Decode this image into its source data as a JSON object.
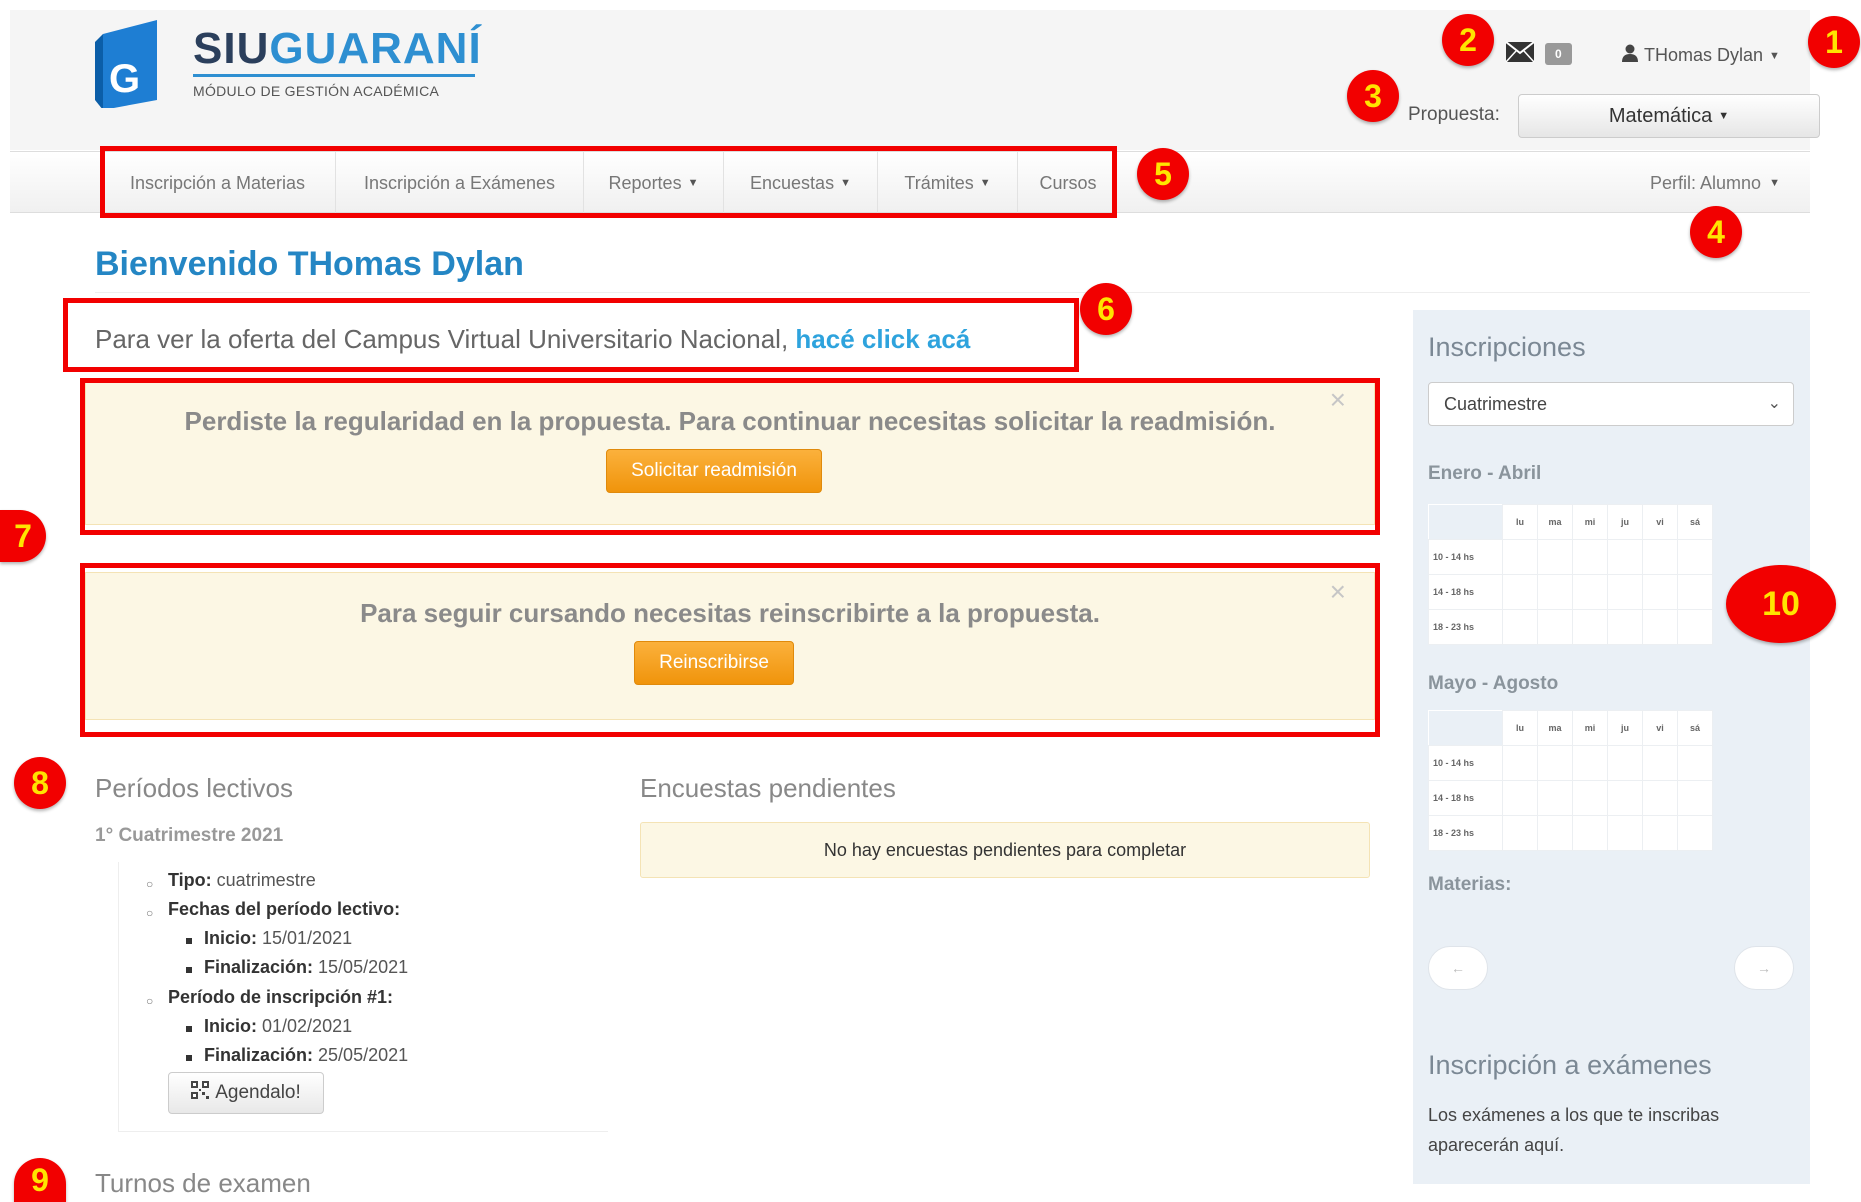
{
  "header": {
    "logo_siu": "SIU",
    "logo_guarani": "GUARANÍ",
    "logo_subtitle": "MÓDULO DE GESTIÓN ACADÉMICA",
    "mail_count": "0",
    "user_name": "THomas Dylan",
    "propuesta_label": "Propuesta:",
    "propuesta_value": "Matemática"
  },
  "nav": {
    "items": [
      {
        "label": "Inscripción a Materias"
      },
      {
        "label": "Inscripción a Exámenes"
      },
      {
        "label": "Reportes"
      },
      {
        "label": "Encuestas"
      },
      {
        "label": "Trámites"
      },
      {
        "label": "Cursos"
      }
    ],
    "perfil": "Perfil: Alumno"
  },
  "markers": [
    "1",
    "2",
    "3",
    "4",
    "5",
    "6",
    "7",
    "8",
    "9",
    "10"
  ],
  "main": {
    "welcome": "Bienvenido THomas Dylan",
    "oferta_text": "Para ver la oferta del Campus Virtual Universitario Nacional,",
    "oferta_link": "hacé click acá",
    "alert1": {
      "text": "Perdiste la regularidad en la propuesta. Para continuar necesitas solicitar la readmisión.",
      "button": "Solicitar readmisión",
      "close": "×"
    },
    "alert2": {
      "text": "Para seguir cursando necesitas reinscribirte a la propuesta.",
      "button": "Reinscribirse",
      "close": "×"
    },
    "periodos": {
      "title": "Períodos lectivos",
      "subtitle": "1° Cuatrimestre 2021",
      "tipo_label": "Tipo:",
      "tipo_value": "cuatrimestre",
      "fechas_label": "Fechas del período lectivo:",
      "inicio_label": "Inicio:",
      "inicio_value": "15/01/2021",
      "fin_label": "Finalización:",
      "fin_value": "15/05/2021",
      "insc_label": "Período de inscripción #1:",
      "insc_inicio_label": "Inicio:",
      "insc_inicio_value": "01/02/2021",
      "insc_fin_label": "Finalización:",
      "insc_fin_value": "25/05/2021",
      "agendalo": "Agendalo!"
    },
    "encuestas": {
      "title": "Encuestas pendientes",
      "empty": "No hay encuestas pendientes para completar"
    },
    "turnos": {
      "title": "Turnos de examen"
    }
  },
  "sidebar": {
    "title": "Inscripciones",
    "select_value": "Cuatrimestre",
    "period1": "Enero - Abril",
    "period2": "Mayo - Agosto",
    "days": [
      "lu",
      "ma",
      "mi",
      "ju",
      "vi",
      "sá"
    ],
    "slots": [
      "10 - 14 hs",
      "14 - 18 hs",
      "18 - 23 hs"
    ],
    "materias": "Materias:",
    "prev": "←",
    "next": "→",
    "examenes_title": "Inscripción a exámenes",
    "examenes_text": "Los exámenes a los que te inscribas aparecerán aquí."
  },
  "colors": {
    "brand_blue": "#2486c4",
    "annotation_red": "#f20000",
    "annotation_yellow": "#ffe400",
    "warning_bg": "#fcf7e4",
    "orange_button": "#f0940b"
  }
}
